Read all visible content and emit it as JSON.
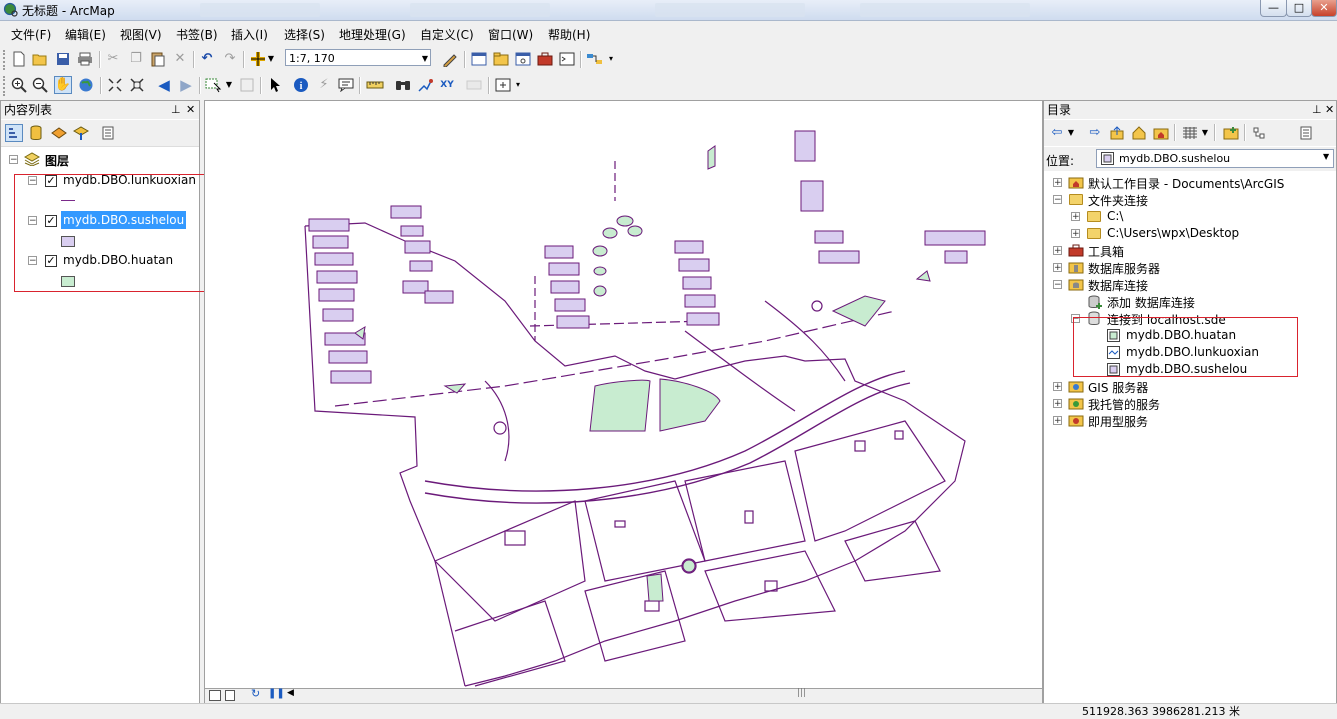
{
  "window": {
    "title": "无标题 - ArcMap",
    "buttons": {
      "minimize": "—",
      "maximize": "□",
      "close": "✕"
    }
  },
  "menubar": [
    "文件(F)",
    "编辑(E)",
    "视图(V)",
    "书签(B)",
    "插入(I)",
    "选择(S)",
    "地理处理(G)",
    "自定义(C)",
    "窗口(W)",
    "帮助(H)"
  ],
  "toolbar": {
    "scale_value": "1:7, 170"
  },
  "toc": {
    "title": "内容列表",
    "root_label": "图层",
    "layers": [
      {
        "name": "mydb.DBO.lunkuoxian",
        "checked": true,
        "symbol": "line",
        "color": "#7a2a8a"
      },
      {
        "name": "mydb.DBO.sushelou",
        "checked": true,
        "symbol": "fill",
        "color": "#d9cef0"
      },
      {
        "name": "mydb.DBO.huatan",
        "checked": true,
        "symbol": "fill",
        "color": "#c8ecd0"
      }
    ]
  },
  "catalog": {
    "title": "目录",
    "location_label": "位置:",
    "location_value": "mydb.DBO.sushelou",
    "items": [
      {
        "label": "默认工作目录 - Documents\\ArcGIS",
        "expander": "+"
      },
      {
        "label": "文件夹连接",
        "expander": "−"
      },
      {
        "label": "C:\\",
        "expander": "+"
      },
      {
        "label": "C:\\Users\\wpx\\Desktop",
        "expander": "+"
      },
      {
        "label": "工具箱",
        "expander": "+"
      },
      {
        "label": "数据库服务器",
        "expander": "+"
      },
      {
        "label": "数据库连接",
        "expander": "−"
      },
      {
        "label": "添加 数据库连接",
        "expander": ""
      },
      {
        "label": "连接到 localhost.sde",
        "expander": "−"
      },
      {
        "label": "mydb.DBO.huatan",
        "expander": ""
      },
      {
        "label": "mydb.DBO.lunkuoxian",
        "expander": ""
      },
      {
        "label": "mydb.DBO.sushelou",
        "expander": ""
      },
      {
        "label": "GIS 服务器",
        "expander": "+"
      },
      {
        "label": "我托管的服务",
        "expander": "+"
      },
      {
        "label": "即用型服务",
        "expander": "+"
      }
    ]
  },
  "status": {
    "coordinates": "511928.363  3986281.213 米"
  },
  "colors": {
    "map_outline": "#6b1a7a",
    "building_fill": "#d9cef0",
    "green_fill": "#c8ecd0",
    "highlight_box": "#d9232e",
    "selection": "#3399ff"
  }
}
